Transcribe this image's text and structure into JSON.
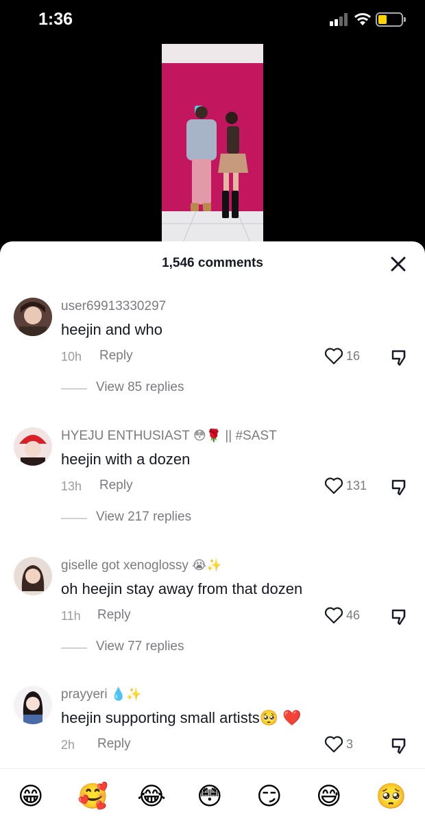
{
  "status_bar": {
    "time": "1:36"
  },
  "comments_panel": {
    "count_label": "1,546 comments",
    "reply_label": "Reply",
    "comments": [
      {
        "username": "user69913330297",
        "username_emoji": "",
        "username_suffix": "",
        "text": "heejin and who",
        "time": "10h",
        "likes": "16",
        "view_replies": "View 85 replies"
      },
      {
        "username": "HYEJU ENTHUSIAST",
        "username_emoji": "😳🌹",
        "username_suffix": "|| #SAST",
        "text": "heejin with a dozen",
        "time": "13h",
        "likes": "131",
        "view_replies": "View 217 replies"
      },
      {
        "username": "giselle got xenoglossy",
        "username_emoji": "😭✨",
        "username_suffix": "",
        "text": "oh heejin stay away from that dozen",
        "time": "11h",
        "likes": "46",
        "view_replies": "View 77 replies"
      },
      {
        "username": "prayyeri",
        "username_emoji": "💧✨",
        "username_suffix": "",
        "text": "heejin supporting small artists🥺 ❤️",
        "time": "2h",
        "likes": "3",
        "view_replies": ""
      }
    ]
  },
  "emoji_bar": [
    "😁",
    "🥰",
    "😂",
    "😳",
    "😏",
    "😅",
    "🥺"
  ],
  "colors": {
    "sheet_bg": "#ffffff",
    "text_primary": "#161823",
    "text_secondary": "#7a7b80",
    "battery": "#ffd400",
    "video_wall": "#c0155e"
  },
  "icons": {
    "close": "close-icon",
    "like": "heart-icon",
    "dislike": "thumbs-down-icon"
  }
}
